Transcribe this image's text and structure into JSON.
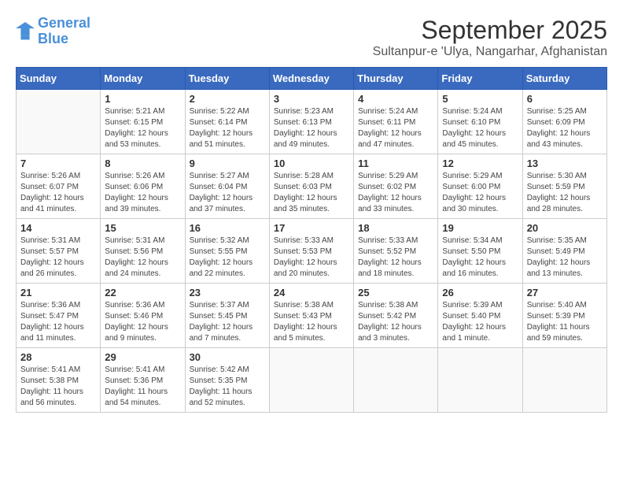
{
  "logo": {
    "line1": "General",
    "line2": "Blue"
  },
  "title": "September 2025",
  "subtitle": "Sultanpur-e 'Ulya, Nangarhar, Afghanistan",
  "days_of_week": [
    "Sunday",
    "Monday",
    "Tuesday",
    "Wednesday",
    "Thursday",
    "Friday",
    "Saturday"
  ],
  "weeks": [
    [
      {
        "day": "",
        "info": ""
      },
      {
        "day": "1",
        "info": "Sunrise: 5:21 AM\nSunset: 6:15 PM\nDaylight: 12 hours\nand 53 minutes."
      },
      {
        "day": "2",
        "info": "Sunrise: 5:22 AM\nSunset: 6:14 PM\nDaylight: 12 hours\nand 51 minutes."
      },
      {
        "day": "3",
        "info": "Sunrise: 5:23 AM\nSunset: 6:13 PM\nDaylight: 12 hours\nand 49 minutes."
      },
      {
        "day": "4",
        "info": "Sunrise: 5:24 AM\nSunset: 6:11 PM\nDaylight: 12 hours\nand 47 minutes."
      },
      {
        "day": "5",
        "info": "Sunrise: 5:24 AM\nSunset: 6:10 PM\nDaylight: 12 hours\nand 45 minutes."
      },
      {
        "day": "6",
        "info": "Sunrise: 5:25 AM\nSunset: 6:09 PM\nDaylight: 12 hours\nand 43 minutes."
      }
    ],
    [
      {
        "day": "7",
        "info": "Sunrise: 5:26 AM\nSunset: 6:07 PM\nDaylight: 12 hours\nand 41 minutes."
      },
      {
        "day": "8",
        "info": "Sunrise: 5:26 AM\nSunset: 6:06 PM\nDaylight: 12 hours\nand 39 minutes."
      },
      {
        "day": "9",
        "info": "Sunrise: 5:27 AM\nSunset: 6:04 PM\nDaylight: 12 hours\nand 37 minutes."
      },
      {
        "day": "10",
        "info": "Sunrise: 5:28 AM\nSunset: 6:03 PM\nDaylight: 12 hours\nand 35 minutes."
      },
      {
        "day": "11",
        "info": "Sunrise: 5:29 AM\nSunset: 6:02 PM\nDaylight: 12 hours\nand 33 minutes."
      },
      {
        "day": "12",
        "info": "Sunrise: 5:29 AM\nSunset: 6:00 PM\nDaylight: 12 hours\nand 30 minutes."
      },
      {
        "day": "13",
        "info": "Sunrise: 5:30 AM\nSunset: 5:59 PM\nDaylight: 12 hours\nand 28 minutes."
      }
    ],
    [
      {
        "day": "14",
        "info": "Sunrise: 5:31 AM\nSunset: 5:57 PM\nDaylight: 12 hours\nand 26 minutes."
      },
      {
        "day": "15",
        "info": "Sunrise: 5:31 AM\nSunset: 5:56 PM\nDaylight: 12 hours\nand 24 minutes."
      },
      {
        "day": "16",
        "info": "Sunrise: 5:32 AM\nSunset: 5:55 PM\nDaylight: 12 hours\nand 22 minutes."
      },
      {
        "day": "17",
        "info": "Sunrise: 5:33 AM\nSunset: 5:53 PM\nDaylight: 12 hours\nand 20 minutes."
      },
      {
        "day": "18",
        "info": "Sunrise: 5:33 AM\nSunset: 5:52 PM\nDaylight: 12 hours\nand 18 minutes."
      },
      {
        "day": "19",
        "info": "Sunrise: 5:34 AM\nSunset: 5:50 PM\nDaylight: 12 hours\nand 16 minutes."
      },
      {
        "day": "20",
        "info": "Sunrise: 5:35 AM\nSunset: 5:49 PM\nDaylight: 12 hours\nand 13 minutes."
      }
    ],
    [
      {
        "day": "21",
        "info": "Sunrise: 5:36 AM\nSunset: 5:47 PM\nDaylight: 12 hours\nand 11 minutes."
      },
      {
        "day": "22",
        "info": "Sunrise: 5:36 AM\nSunset: 5:46 PM\nDaylight: 12 hours\nand 9 minutes."
      },
      {
        "day": "23",
        "info": "Sunrise: 5:37 AM\nSunset: 5:45 PM\nDaylight: 12 hours\nand 7 minutes."
      },
      {
        "day": "24",
        "info": "Sunrise: 5:38 AM\nSunset: 5:43 PM\nDaylight: 12 hours\nand 5 minutes."
      },
      {
        "day": "25",
        "info": "Sunrise: 5:38 AM\nSunset: 5:42 PM\nDaylight: 12 hours\nand 3 minutes."
      },
      {
        "day": "26",
        "info": "Sunrise: 5:39 AM\nSunset: 5:40 PM\nDaylight: 12 hours\nand 1 minute."
      },
      {
        "day": "27",
        "info": "Sunrise: 5:40 AM\nSunset: 5:39 PM\nDaylight: 11 hours\nand 59 minutes."
      }
    ],
    [
      {
        "day": "28",
        "info": "Sunrise: 5:41 AM\nSunset: 5:38 PM\nDaylight: 11 hours\nand 56 minutes."
      },
      {
        "day": "29",
        "info": "Sunrise: 5:41 AM\nSunset: 5:36 PM\nDaylight: 11 hours\nand 54 minutes."
      },
      {
        "day": "30",
        "info": "Sunrise: 5:42 AM\nSunset: 5:35 PM\nDaylight: 11 hours\nand 52 minutes."
      },
      {
        "day": "",
        "info": ""
      },
      {
        "day": "",
        "info": ""
      },
      {
        "day": "",
        "info": ""
      },
      {
        "day": "",
        "info": ""
      }
    ]
  ]
}
